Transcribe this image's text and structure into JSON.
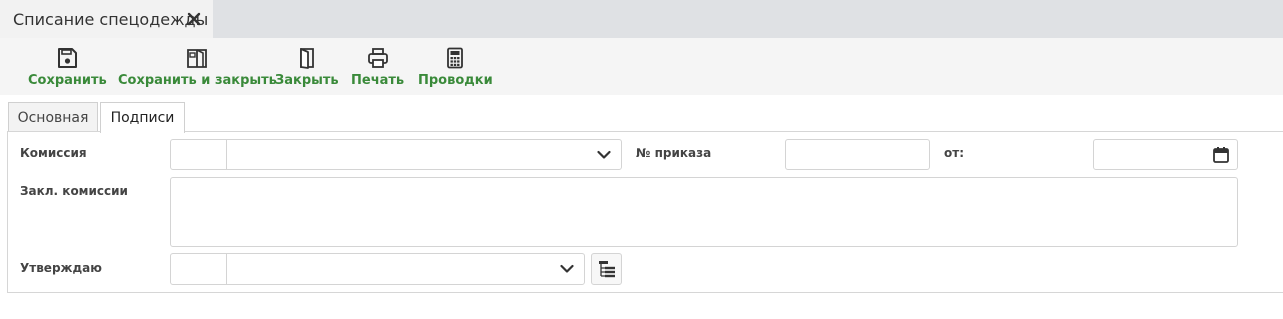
{
  "document_tab": {
    "title": "Списание спецодежды",
    "close_icon": "close-icon"
  },
  "toolbar": {
    "save": "Сохранить",
    "save_close": "Сохранить и закрыть",
    "close": "Закрыть",
    "print": "Печать",
    "postings": "Проводки"
  },
  "tabs": {
    "main": "Основная",
    "signatures": "Подписи",
    "active": "Подписи"
  },
  "form": {
    "commission_label": "Комиссия",
    "commission_code": "",
    "commission_value": "",
    "order_no_label": "№ приказа",
    "order_no_value": "",
    "from_label": "от:",
    "from_value": "",
    "conclusion_label": "Закл. комиссии",
    "conclusion_value": "",
    "approve_label": "Утверждаю",
    "approve_code": "",
    "approve_value": ""
  },
  "colors": {
    "accent": "#3a8a3a",
    "tabbar": "#dfe1e4",
    "toolbar": "#f5f5f5"
  }
}
